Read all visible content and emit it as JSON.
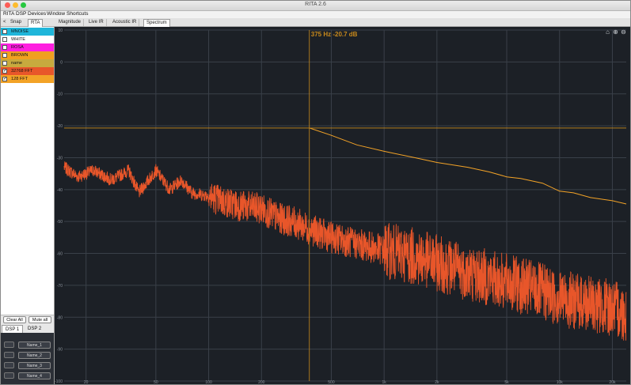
{
  "window": {
    "title": "RITA 2.6"
  },
  "menu": [
    "RITA",
    "DSP",
    "Devices",
    "Window",
    "Shortcuts"
  ],
  "left_tabs": {
    "back": "<",
    "items": [
      "Snap",
      "RTA"
    ],
    "active": 1
  },
  "right_tabs": {
    "items": [
      "Magnitude",
      "Live IR",
      "Acoustic IR",
      "Spectrum"
    ],
    "active": 3
  },
  "signals": [
    {
      "name": "MNOISE",
      "color": "#1fb6da",
      "checked": false
    },
    {
      "name": "WHITE",
      "color": "#ffffff",
      "checked": false
    },
    {
      "name": "ROSA",
      "color": "#ff1fe0",
      "checked": false
    },
    {
      "name": "BROWN",
      "color": "#f0a020",
      "checked": false
    },
    {
      "name": "name",
      "color": "#c7aa3e",
      "checked": false
    },
    {
      "name": "32768 FFT",
      "color": "#e8562a",
      "checked": true
    },
    {
      "name": "128 FFT",
      "color": "#f3a327",
      "checked": true
    }
  ],
  "controls": {
    "clear_all": "Clear All",
    "mute_all": "Mute all"
  },
  "dsp_tabs": [
    "DSP 1",
    "DSP 2"
  ],
  "dsp_slots": [
    "Name_1",
    "Name_2",
    "Name_3",
    "Name_4"
  ],
  "cursor": {
    "readout": "375 Hz  -20.7 dB",
    "freq_hz": 375,
    "level_db": -20.7
  },
  "plot_icons": [
    "home-icon",
    "zoom-in-icon",
    "zoom-out-icon"
  ],
  "chart_data": {
    "type": "line",
    "x_scale": "log",
    "xlim": [
      15,
      24000
    ],
    "ylim": [
      -100,
      10
    ],
    "grid": true,
    "y_ticks": [
      10,
      0,
      -10,
      -20,
      -30,
      -40,
      -50,
      -60,
      -70,
      -80,
      -90,
      -100
    ],
    "x_ticks": [
      20,
      50,
      100,
      200,
      500,
      1000,
      2000,
      5000,
      10000,
      20000
    ],
    "series": [
      {
        "name": "32768 FFT",
        "color": "#e8562a",
        "x": [
          15,
          18,
          22,
          28,
          35,
          40,
          50,
          60,
          70,
          80,
          100,
          125,
          150,
          200,
          250,
          300,
          400,
          500,
          700,
          1000,
          1500,
          2000,
          3000,
          5000,
          7000,
          10000,
          15000,
          20000,
          24000
        ],
        "y": [
          -33,
          -36,
          -34,
          -37,
          -34,
          -41,
          -34,
          -40,
          -37,
          -41,
          -42,
          -44,
          -45,
          -46,
          -49,
          -50,
          -53,
          -55,
          -57,
          -59,
          -61,
          -63,
          -66,
          -69,
          -71,
          -74,
          -76,
          -77,
          -79
        ]
      },
      {
        "name": "128 FFT",
        "color": "#f3a327",
        "x": [
          375,
          500,
          700,
          1000,
          1500,
          2000,
          3000,
          4000,
          5000,
          6000,
          8000,
          10000,
          12000,
          15000,
          20000,
          24000
        ],
        "y": [
          -20.7,
          -23,
          -26,
          -28,
          -30,
          -31.5,
          -33,
          -34.5,
          -36,
          -36.5,
          -38,
          -40.5,
          -41,
          -42.5,
          -43.5,
          -44.5
        ]
      }
    ]
  }
}
